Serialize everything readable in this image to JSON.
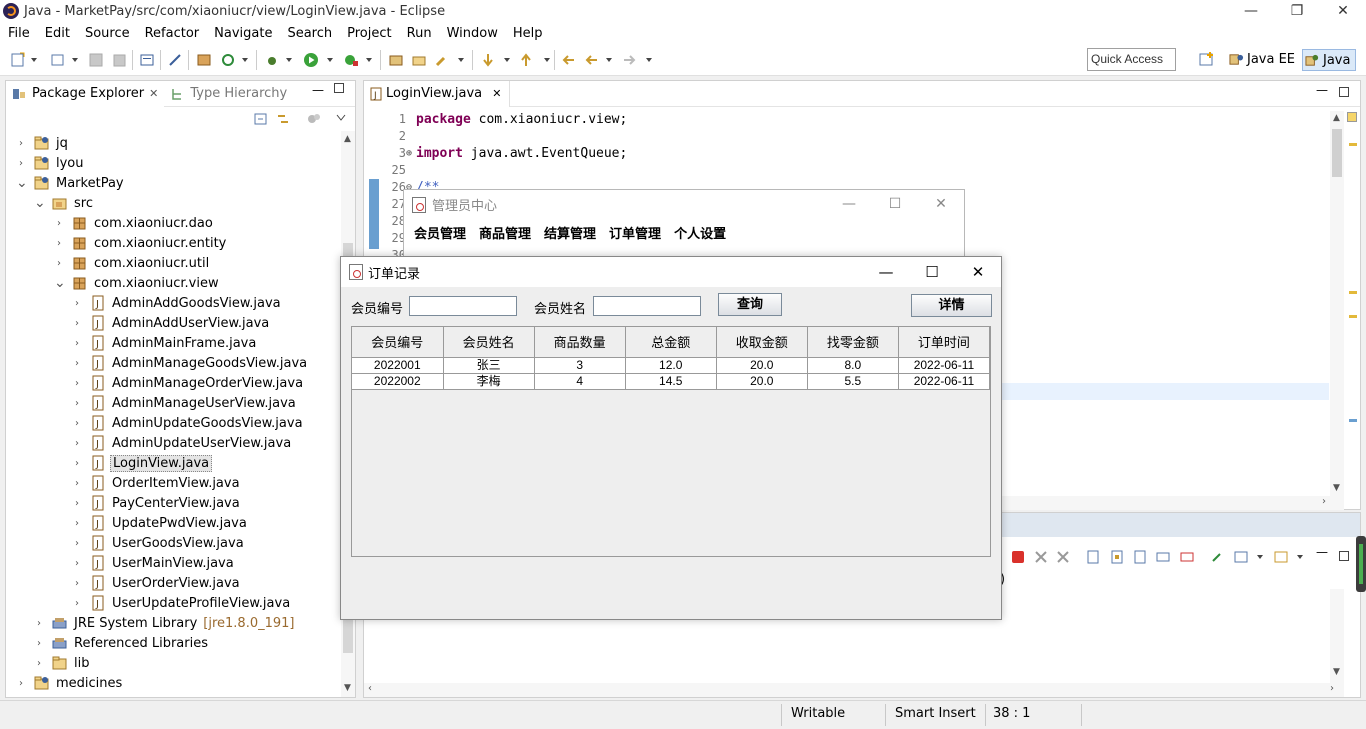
{
  "window": {
    "title": "Java - MarketPay/src/com/xiaoniucr/view/LoginView.java - Eclipse",
    "minimize": "—",
    "restore": "❐",
    "close": "✕"
  },
  "menubar": [
    "File",
    "Edit",
    "Source",
    "Refactor",
    "Navigate",
    "Search",
    "Project",
    "Run",
    "Window",
    "Help"
  ],
  "toolbar": {
    "quick_access": "Quick Access",
    "perspectives": [
      "Java EE",
      "Java"
    ]
  },
  "package_explorer": {
    "tabs": {
      "active": "Package Explorer",
      "inactive": "Type Hierarchy"
    },
    "tree": [
      {
        "label": "jq",
        "level": 0,
        "icon": "project-icon",
        "expanded": false
      },
      {
        "label": "lyou",
        "level": 0,
        "icon": "project-icon",
        "expanded": false
      },
      {
        "label": "MarketPay",
        "level": 0,
        "icon": "project-icon",
        "expanded": true
      },
      {
        "label": "src",
        "level": 1,
        "icon": "src-folder-icon",
        "expanded": true
      },
      {
        "label": "com.xiaoniucr.dao",
        "level": 2,
        "icon": "package-icon",
        "expanded": false
      },
      {
        "label": "com.xiaoniucr.entity",
        "level": 2,
        "icon": "package-icon",
        "expanded": false
      },
      {
        "label": "com.xiaoniucr.util",
        "level": 2,
        "icon": "package-icon",
        "expanded": false
      },
      {
        "label": "com.xiaoniucr.view",
        "level": 2,
        "icon": "package-icon",
        "expanded": true
      },
      {
        "label": "AdminAddGoodsView.java",
        "level": 3,
        "icon": "java-file-icon",
        "expanded": false
      },
      {
        "label": "AdminAddUserView.java",
        "level": 3,
        "icon": "java-file-icon",
        "expanded": false
      },
      {
        "label": "AdminMainFrame.java",
        "level": 3,
        "icon": "java-file-icon",
        "expanded": false
      },
      {
        "label": "AdminManageGoodsView.java",
        "level": 3,
        "icon": "java-file-icon",
        "expanded": false
      },
      {
        "label": "AdminManageOrderView.java",
        "level": 3,
        "icon": "java-file-icon",
        "expanded": false
      },
      {
        "label": "AdminManageUserView.java",
        "level": 3,
        "icon": "java-file-icon",
        "expanded": false
      },
      {
        "label": "AdminUpdateGoodsView.java",
        "level": 3,
        "icon": "java-file-icon",
        "expanded": false
      },
      {
        "label": "AdminUpdateUserView.java",
        "level": 3,
        "icon": "java-file-icon",
        "expanded": false
      },
      {
        "label": "LoginView.java",
        "level": 3,
        "icon": "java-file-icon",
        "expanded": false,
        "selected": true
      },
      {
        "label": "OrderItemView.java",
        "level": 3,
        "icon": "java-file-icon",
        "expanded": false
      },
      {
        "label": "PayCenterView.java",
        "level": 3,
        "icon": "java-file-icon",
        "expanded": false
      },
      {
        "label": "UpdatePwdView.java",
        "level": 3,
        "icon": "java-file-icon",
        "expanded": false
      },
      {
        "label": "UserGoodsView.java",
        "level": 3,
        "icon": "java-file-icon",
        "expanded": false
      },
      {
        "label": "UserMainView.java",
        "level": 3,
        "icon": "java-file-icon",
        "expanded": false
      },
      {
        "label": "UserOrderView.java",
        "level": 3,
        "icon": "java-file-icon",
        "expanded": false
      },
      {
        "label": "UserUpdateProfileView.java",
        "level": 3,
        "icon": "java-file-icon",
        "expanded": false
      },
      {
        "label": "JRE System Library",
        "suffix": "[jre1.8.0_191]",
        "level": 1,
        "icon": "library-icon",
        "expanded": false
      },
      {
        "label": "Referenced Libraries",
        "level": 1,
        "icon": "library-icon",
        "expanded": false
      },
      {
        "label": "lib",
        "level": 1,
        "icon": "folder-icon",
        "expanded": false
      },
      {
        "label": "medicines",
        "level": 0,
        "icon": "project-icon",
        "expanded": false
      }
    ]
  },
  "editor": {
    "tab": "LoginView.java",
    "lines": [
      {
        "num": "1",
        "kw": "package",
        "rest": " com.xiaoniucr.view;"
      },
      {
        "num": "2",
        "kw": "",
        "rest": ""
      },
      {
        "num": "3",
        "kw": "import",
        "rest": " java.awt.EventQueue;",
        "fold": "⊕"
      },
      {
        "num": "25",
        "kw": "",
        "rest": ""
      },
      {
        "num": "26",
        "kw": "",
        "rest": "/**",
        "comment": true,
        "fold": "⊖"
      },
      {
        "num": "27",
        "kw": "",
        "rest": ""
      },
      {
        "num": "28",
        "kw": "",
        "rest": ""
      },
      {
        "num": "29",
        "kw": "",
        "rest": ""
      },
      {
        "num": "30",
        "kw": "",
        "rest": ""
      }
    ]
  },
  "console": {
    "fragment": ")"
  },
  "statusbar": {
    "writable": "Writable",
    "insert_mode": "Smart Insert",
    "position": "38 : 1"
  },
  "admin_window": {
    "title": "管理员中心",
    "menus": [
      "会员管理",
      "商品管理",
      "结算管理",
      "订单管理",
      "个人设置"
    ]
  },
  "order_window": {
    "title": "订单记录",
    "member_id_label": "会员编号",
    "member_id_value": "",
    "member_name_label": "会员姓名",
    "member_name_value": "",
    "query_button": "查询",
    "detail_button": "详情",
    "columns": [
      "会员编号",
      "会员姓名",
      "商品数量",
      "总金额",
      "收取金额",
      "找零金额",
      "订单时间"
    ],
    "rows": [
      [
        "2022001",
        "张三",
        "3",
        "12.0",
        "20.0",
        "8.0",
        "2022-06-11"
      ],
      [
        "2022002",
        "李梅",
        "4",
        "14.5",
        "20.0",
        "5.5",
        "2022-06-11"
      ]
    ]
  },
  "colors": {
    "keyword": "#7f0055",
    "comment": "#3f5fbf",
    "selection": "#e5e5e5",
    "active_perspective": "#dbe9f8"
  }
}
